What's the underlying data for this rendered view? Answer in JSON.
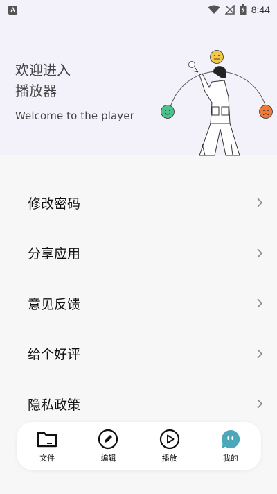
{
  "status_bar": {
    "app_badge": "A",
    "time": "8:44"
  },
  "hero": {
    "title_line1": "欢迎进入",
    "title_line2": "播放器",
    "subtitle": "Welcome to the player",
    "faces": [
      "happy-face-green",
      "neutral-face-yellow",
      "sad-face-orange"
    ],
    "colors": {
      "background": "#f3f2fb",
      "green": "#4cc28a",
      "yellow": "#f5c842",
      "orange": "#f07a3a"
    }
  },
  "menu": {
    "items": [
      {
        "label": "修改密码"
      },
      {
        "label": "分享应用"
      },
      {
        "label": "意见反馈"
      },
      {
        "label": "给个好评"
      },
      {
        "label": "隐私政策"
      }
    ]
  },
  "tab_bar": {
    "tabs": [
      {
        "label": "文件",
        "icon": "folder-icon"
      },
      {
        "label": "编辑",
        "icon": "edit-pencil-icon"
      },
      {
        "label": "播放",
        "icon": "play-icon"
      },
      {
        "label": "我的",
        "icon": "profile-bubble-icon",
        "active_color": "#4aa8b8"
      }
    ]
  }
}
